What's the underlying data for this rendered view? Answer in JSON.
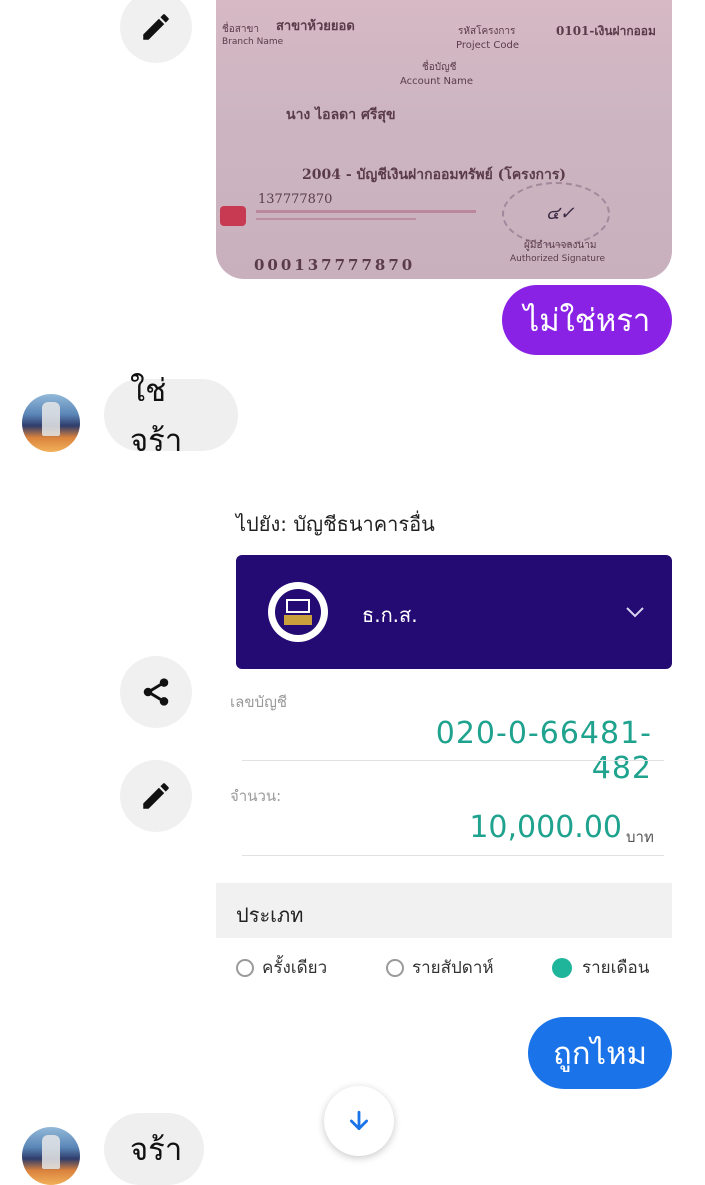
{
  "passbook": {
    "branch_label": "ชื่อสาขา",
    "branch_label_en": "Branch Name",
    "branch_value": "สาขาห้วยยอด",
    "project_code_label": "รหัสโครงการ",
    "project_code_label_en": "Project Code",
    "project_code_value": "0101-เงินฝากออม",
    "account_name_label": "ชื่อบัญชี",
    "account_name_label_en": "Account Name",
    "account_name_value": "นาง ไอลดา ศรีสุข",
    "account_type": "2004 - บัญชีเงินฝากออมทรัพย์ (โครงการ)",
    "short_number": "137777870",
    "account_number": "000137777870",
    "signature_label": "ผู้มีอำนาจลงนาม",
    "signature_label_en": "Authorized Signature"
  },
  "messages": {
    "out1": "ไม่ใช่หรา",
    "in1": "ใช่จร้า",
    "out2": "ถูกไหม",
    "in2": "จร้า"
  },
  "transfer": {
    "to_label": "ไปยัง: บัญชีธนาคารอื่น",
    "bank_name": "ธ.ก.ส.",
    "account_label": "เลขบัญชี",
    "account_value": "020-0-66481-482",
    "amount_label": "จำนวน:",
    "amount_value": "10,000.00",
    "currency": "บาท",
    "type_label": "ประเภท",
    "options": [
      "ครั้งเดียว",
      "รายสัปดาห์",
      "รายเดือน"
    ],
    "selected_option": "รายเดือน"
  },
  "icons": {
    "edit": "pencil-icon",
    "share": "share-icon",
    "dropdown": "chevron-down-icon",
    "scroll": "arrow-down-icon"
  },
  "colors": {
    "outgoing_purple": "#8a22e6",
    "outgoing_blue": "#1a73e8",
    "bank_bar": "#240a73",
    "accent_teal": "#1fa38f"
  }
}
